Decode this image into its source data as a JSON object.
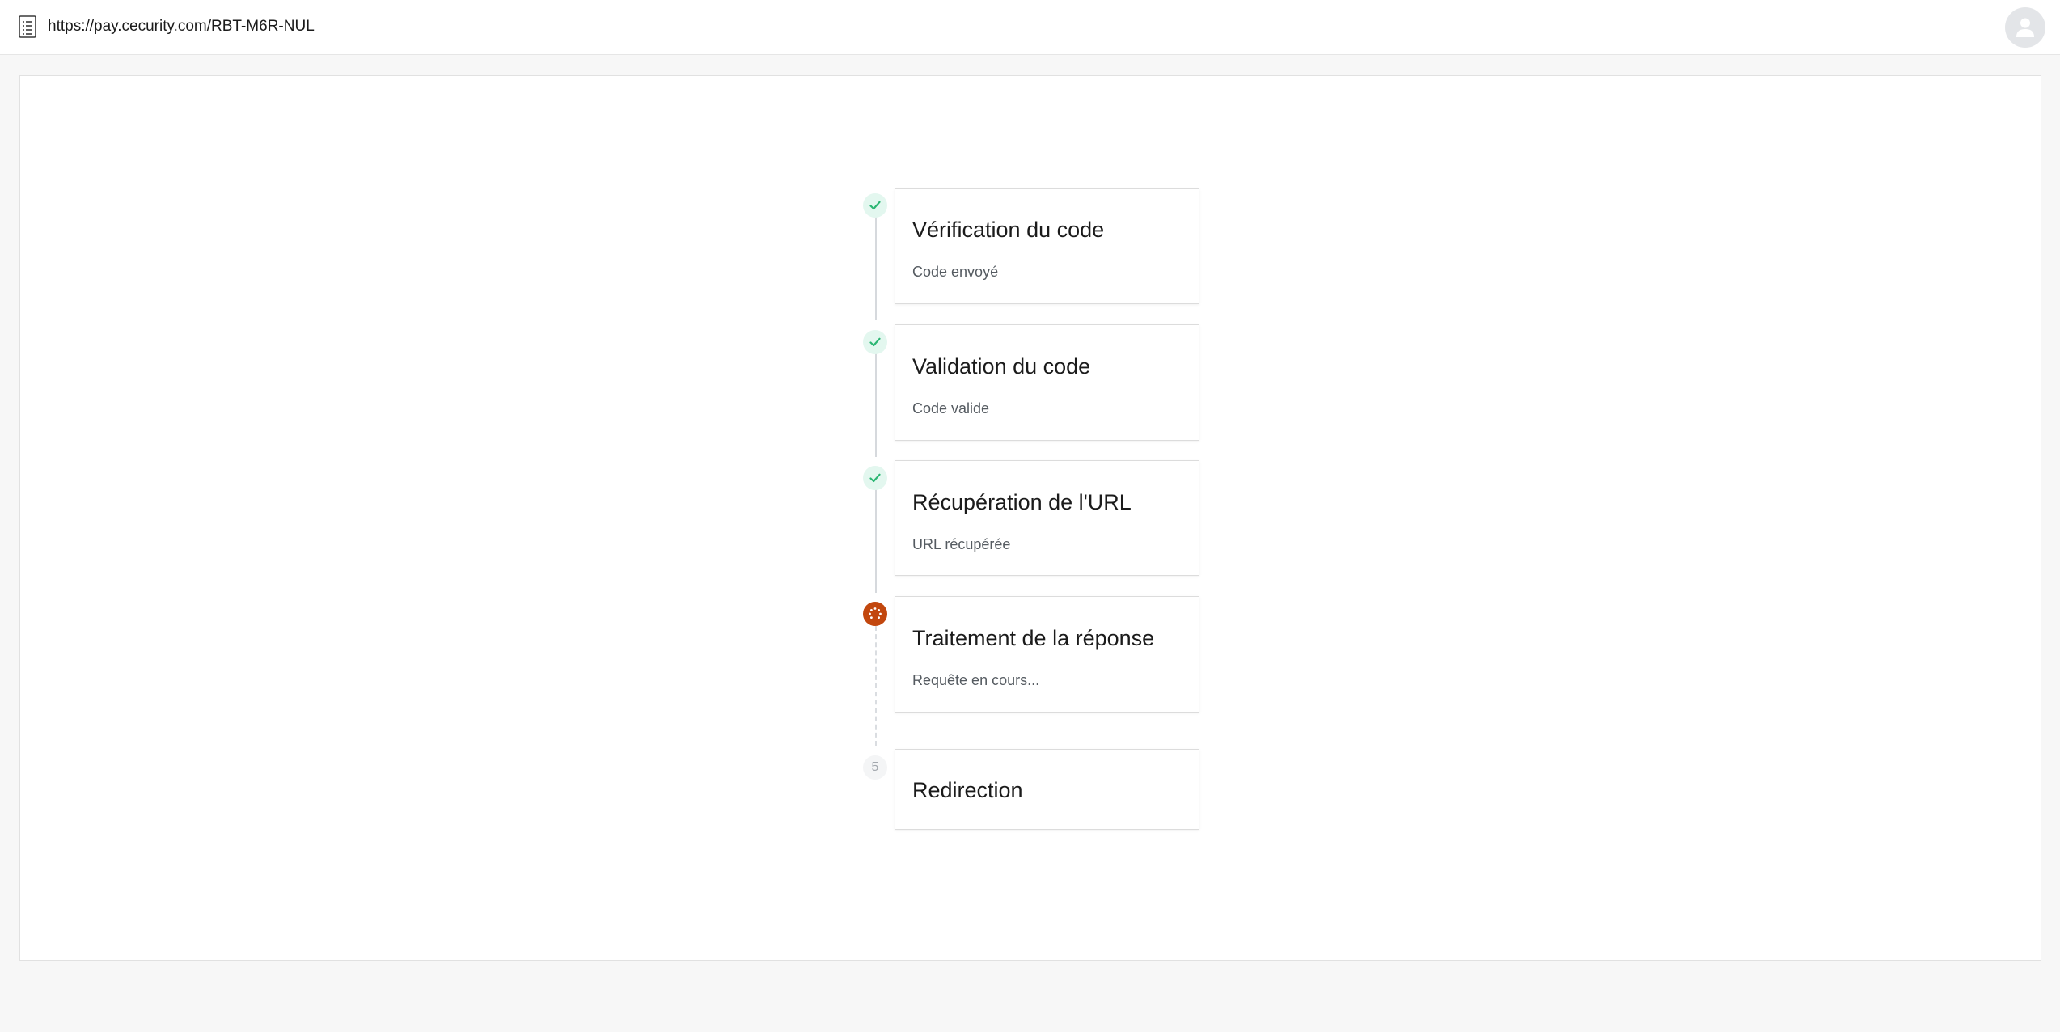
{
  "address_bar": {
    "url": "https://pay.cecurity.com/RBT-M6R-NUL",
    "page_icon": "document-list-icon"
  },
  "profile": {
    "icon": "user-avatar-icon"
  },
  "colors": {
    "done": "#2bb673",
    "active": "#c2470e",
    "pending": "#a3a8ae"
  },
  "steps": [
    {
      "title": "Vérification du code",
      "subtitle": "Code envoyé",
      "status": "done",
      "icon": "check-icon"
    },
    {
      "title": "Validation du code",
      "subtitle": "Code valide",
      "status": "done",
      "icon": "check-icon"
    },
    {
      "title": "Récupération de l'URL",
      "subtitle": "URL récupérée",
      "status": "done",
      "icon": "check-icon"
    },
    {
      "title": "Traitement de la réponse",
      "subtitle": "Requête en cours...",
      "status": "active",
      "icon": "spinner-icon"
    },
    {
      "title": "Redirection",
      "subtitle": "",
      "status": "pending",
      "number": "5"
    }
  ]
}
